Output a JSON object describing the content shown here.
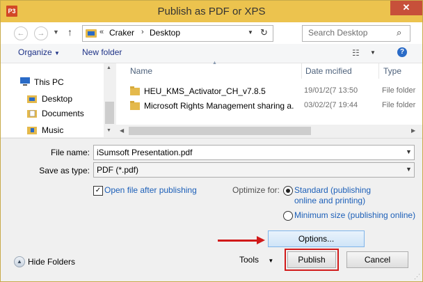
{
  "window": {
    "title": "Publish as PDF or XPS",
    "app_icon": "P3",
    "close_glyph": "✕"
  },
  "address": {
    "chevron": "«",
    "path": [
      "Craker",
      "Desktop"
    ],
    "search_placeholder": "Search Desktop"
  },
  "toolbar": {
    "organize_label": "Organize",
    "new_folder_label": "New folder"
  },
  "nav": {
    "items": [
      {
        "label": "This PC",
        "icon": "computer-icon"
      },
      {
        "label": "Desktop",
        "icon": "desktop-folder-icon"
      },
      {
        "label": "Documents",
        "icon": "documents-folder-icon"
      },
      {
        "label": "Music",
        "icon": "music-folder-icon"
      }
    ]
  },
  "files": {
    "columns": [
      "Name",
      "Date mcified",
      "Type"
    ],
    "rows": [
      {
        "name": "HEU_KMS_Activator_CH_v7.8.5",
        "date": "19/01/2(7 13:50",
        "type": "File folder"
      },
      {
        "name": "Microsoft Rights Management sharing a.",
        "date": "03/02/2(7 19:44",
        "type": "File folder"
      }
    ]
  },
  "form": {
    "file_name_label": "File name:",
    "file_name_value": "iSumsoft Presentation.pdf",
    "save_as_type_label": "Save as type:",
    "save_as_type_value": "PDF (*.pdf)",
    "open_after_label": "Open file after publishing",
    "open_after_checked": true,
    "optimize_label": "Optimize for:",
    "opt_standard_line1": "Standard (publishing",
    "opt_standard_line2": "online and printing)",
    "opt_minimum": "Minimum size (publishing online)",
    "selected_option": "standard",
    "options_button": "Options...",
    "hide_folders_label": "Hide Folders",
    "tools_label": "Tools",
    "publish_button": "Publish",
    "cancel_button": "Cancel"
  },
  "colors": {
    "title_bar": "#ecc34e",
    "annotation_red": "#d11a1a",
    "link_blue": "#1c5fb8"
  }
}
